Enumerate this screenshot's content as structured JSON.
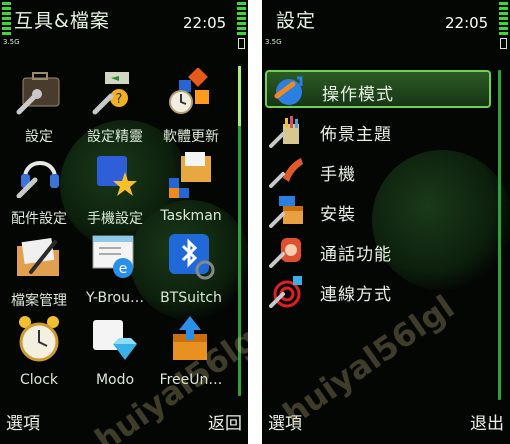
{
  "left": {
    "title": "互具&檔案",
    "time": "22:05",
    "network": "3.5G",
    "items": [
      {
        "label": "設定",
        "icon": "settings-toolbox-icon"
      },
      {
        "label": "設定精靈",
        "icon": "settings-wizard-icon"
      },
      {
        "label": "軟體更新",
        "icon": "software-update-icon"
      },
      {
        "label": "配件設定",
        "icon": "accessory-settings-icon"
      },
      {
        "label": "手機設定",
        "icon": "phone-setup-icon"
      },
      {
        "label": "Taskman",
        "icon": "task-manager-icon"
      },
      {
        "label": "檔案管理",
        "icon": "file-manager-icon"
      },
      {
        "label": "Y-Brou…",
        "icon": "web-browser-icon"
      },
      {
        "label": "BTSuitch",
        "icon": "bluetooth-switch-icon"
      },
      {
        "label": "Clock",
        "icon": "alarm-clock-icon"
      },
      {
        "label": "Modo",
        "icon": "modo-gem-icon"
      },
      {
        "label": "FreeUn…",
        "icon": "free-uninstaller-icon"
      }
    ],
    "softkey_left": "選項",
    "softkey_right": "返回"
  },
  "right": {
    "title": "設定",
    "time": "22:05",
    "network": "3.5G",
    "items": [
      {
        "label": "操作模式",
        "icon": "profile-mode-icon",
        "selected": true
      },
      {
        "label": "佈景主題",
        "icon": "themes-icon",
        "selected": false
      },
      {
        "label": "手機",
        "icon": "phone-icon",
        "selected": false
      },
      {
        "label": "安裝",
        "icon": "installation-icon",
        "selected": false
      },
      {
        "label": "通話功能",
        "icon": "call-settings-icon",
        "selected": false
      },
      {
        "label": "連線方式",
        "icon": "connectivity-icon",
        "selected": false
      }
    ],
    "softkey_left": "選項",
    "softkey_right": "退出"
  },
  "watermark": "huiyal56lgl",
  "colors": {
    "accent": "#3fd63a",
    "selected_border": "#6fd24f",
    "background": "#040604"
  }
}
